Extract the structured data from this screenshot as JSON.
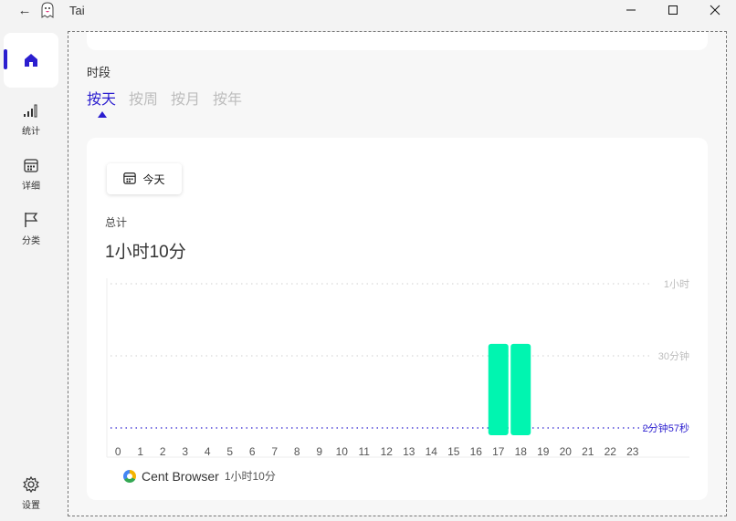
{
  "window": {
    "title": "Tai",
    "back_icon": "arrow-left-icon"
  },
  "sidebar": {
    "items": [
      {
        "label": "",
        "icon": "home-icon",
        "active": true
      },
      {
        "label": "统计",
        "icon": "signal-bars-icon"
      },
      {
        "label": "详细",
        "icon": "calendar-icon"
      },
      {
        "label": "分类",
        "icon": "flag-icon"
      }
    ],
    "settings_label": "设置"
  },
  "period": {
    "label": "时段",
    "tabs": [
      "按天",
      "按周",
      "按月",
      "按年"
    ],
    "active_index": 0
  },
  "date_button": {
    "label": "今天",
    "icon": "calendar-icon"
  },
  "summary": {
    "label": "总计",
    "value": "1小时10分"
  },
  "colors": {
    "accent": "#2b1ecf",
    "bar": "#00f5b0",
    "grid": "#cfcfcf",
    "axis_label": "#bdbdbd"
  },
  "chart_data": {
    "type": "bar",
    "categories": [
      "0",
      "1",
      "2",
      "3",
      "4",
      "5",
      "6",
      "7",
      "8",
      "9",
      "10",
      "11",
      "12",
      "13",
      "14",
      "15",
      "16",
      "17",
      "18",
      "19",
      "20",
      "21",
      "22",
      "23"
    ],
    "values": [
      0,
      0,
      0,
      0,
      0,
      0,
      0,
      0,
      0,
      0,
      0,
      0,
      0,
      0,
      0,
      0,
      0,
      35,
      35,
      0,
      0,
      0,
      0,
      0
    ],
    "y_unit": "minutes",
    "ylim": [
      0,
      60
    ],
    "reference_lines": [
      {
        "label": "1小时",
        "value": 60
      },
      {
        "label": "30分钟",
        "value": 30
      },
      {
        "label": "2分钟57秒",
        "value": 2.95,
        "highlight": true
      }
    ],
    "legend": [
      {
        "name": "Cent Browser",
        "value": "1小时10分"
      }
    ]
  }
}
